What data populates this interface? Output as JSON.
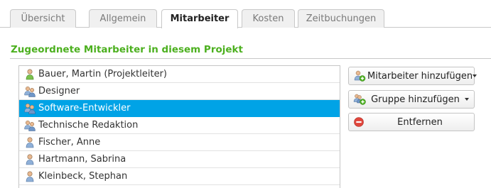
{
  "tabs": [
    {
      "label": "Übersicht",
      "active": false
    },
    {
      "label": "Allgemein",
      "active": false
    },
    {
      "label": "Mitarbeiter",
      "active": true
    },
    {
      "label": "Kosten",
      "active": false
    },
    {
      "label": "Zeitbuchungen",
      "active": false
    }
  ],
  "section": {
    "title": "Zugeordnete Mitarbeiter in diesem Projekt"
  },
  "members": [
    {
      "label": "Bauer, Martin (Projektleiter)",
      "icon": "user-green-icon",
      "selected": false
    },
    {
      "label": "Designer",
      "icon": "group-icon",
      "selected": false
    },
    {
      "label": "Software-Entwickler",
      "icon": "group-icon",
      "selected": true
    },
    {
      "label": "Technische Redaktion",
      "icon": "group-icon",
      "selected": false
    },
    {
      "label": "Fischer, Anne",
      "icon": "user-icon",
      "selected": false
    },
    {
      "label": "Hartmann, Sabrina",
      "icon": "user-icon",
      "selected": false
    },
    {
      "label": "Kleinbeck, Stephan",
      "icon": "user-icon",
      "selected": false
    }
  ],
  "actions": {
    "add_member_label": "Mitarbeiter hinzufügen",
    "add_group_label": "Gruppe hinzufügen",
    "remove_label": "Entfernen"
  },
  "colors": {
    "accent_green": "#4cb01f",
    "selection_blue": "#00a3e6",
    "remove_red": "#e0463c"
  }
}
